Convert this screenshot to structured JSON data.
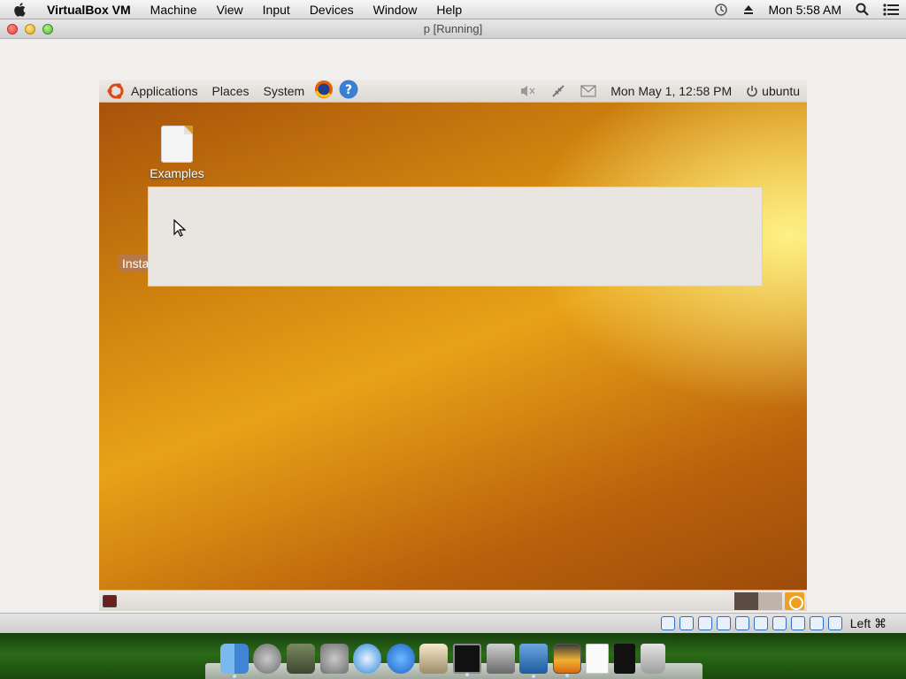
{
  "mac_menubar": {
    "app_name": "VirtualBox VM",
    "menus": [
      "Machine",
      "View",
      "Input",
      "Devices",
      "Window",
      "Help"
    ],
    "clock": "Mon 5:58 AM"
  },
  "vm_window": {
    "title": "p [Running]"
  },
  "guest": {
    "top_panel": {
      "menus": [
        "Applications",
        "Places",
        "System"
      ],
      "clock": "Mon May  1, 12:58 PM",
      "user": "ubuntu"
    },
    "desktop": {
      "icons": [
        {
          "label": "Examples"
        }
      ],
      "install_label": "Insta"
    }
  },
  "vm_status": {
    "host_key": "Left ⌘"
  },
  "dock": {
    "items": [
      "finder",
      "launchpad",
      "preview",
      "system-preferences",
      "safari",
      "app-store",
      "wizard",
      "terminal",
      "facetime",
      "virtualbox",
      "vm-window",
      "document",
      "phone",
      "trash"
    ]
  }
}
